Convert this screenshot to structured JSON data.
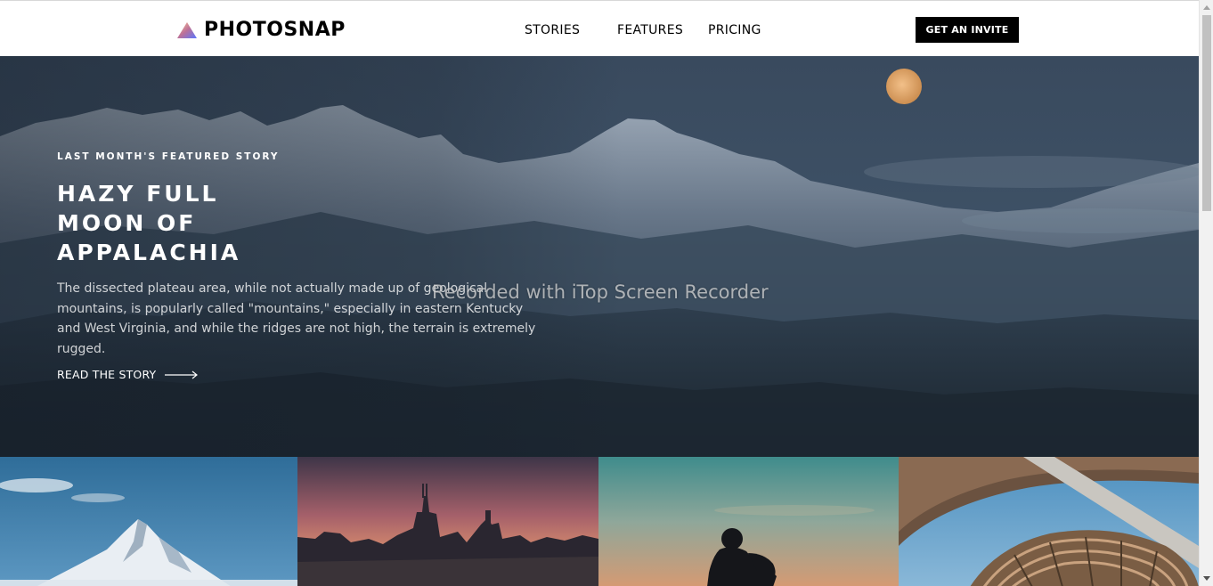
{
  "header": {
    "brand": "PHOTOSNAP",
    "nav": [
      {
        "id": "stories",
        "label": "STORIES"
      },
      {
        "id": "features",
        "label": "FEATURES"
      },
      {
        "id": "pricing",
        "label": "PRICING"
      }
    ],
    "cta_label": "GET AN INVITE"
  },
  "hero": {
    "kicker": "LAST MONTH'S FEATURED STORY",
    "title": "HAZY FULL MOON OF APPALACHIA",
    "description": "The dissected plateau area, while not actually made up of geological mountains, is popularly called \"mountains,\" especially in eastern Kentucky and West Virginia, and while the ridges are not high, the terrain is extremely rugged.",
    "link_label": "READ THE STORY"
  },
  "watermark": "Recorded with iTop Screen Recorder",
  "icons": {
    "logo": "triangle-gradient-logo-icon",
    "link": "arrow-right-icon"
  },
  "colors": {
    "brand_gradient": [
      "#FFC593",
      "#BC7198",
      "#5A77FF"
    ],
    "cta_bg": "#000000",
    "hero_bg": "#3a4a5d"
  }
}
